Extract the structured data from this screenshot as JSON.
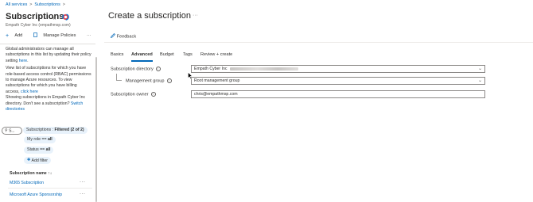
{
  "breadcrumb": [
    "All services",
    "Subscriptions"
  ],
  "left": {
    "title": "Subscriptions",
    "subtitle": "Empath Cyber Inc (empathmsp.com)",
    "toolbar": {
      "add": "Add",
      "manage_policies": "Manage Policies",
      "more": "···"
    },
    "info_p1_a": "Global administrators can manage all subscriptions in this list by updating their policy setting ",
    "info_p1_link": "here",
    "info_p1_b": ".",
    "info_p2_a": "View list of subscriptions for which you have role-based access control (RBAC) permissions to manage Azure resources. To view subscriptions for which you have billing access, ",
    "info_p2_link": "click here",
    "info_p3_a": "Showing subscriptions in Empath Cyber Inc directory. Don't see a subscription? ",
    "info_p3_link": "Switch directories",
    "search_placeholder": "S...",
    "filters": {
      "subscriptions_label": "Subscriptions : ",
      "subscriptions_value": "Filtered (2 of 2)",
      "role_label": "My role == ",
      "role_value": "all",
      "status_label": "Status == ",
      "status_value": "all",
      "add_filter": "Add filter"
    },
    "list_header": "Subscription name",
    "sort_glyph": "↑↓",
    "rows": [
      {
        "name": "M365 Subscription",
        "more": "···"
      },
      {
        "name": "Microsoft Azure Sponsorship",
        "more": "···"
      }
    ]
  },
  "main": {
    "title": "Create a subscription",
    "title_more": "···",
    "feedback": "Feedback",
    "tabs": [
      "Basics",
      "Advanced",
      "Budget",
      "Tags",
      "Review + create"
    ],
    "active_tab": "Advanced",
    "form": {
      "directory_label": "Subscription directory",
      "directory_value": "Empath Cyber Inc",
      "mgmt_group_label": "Management group",
      "mgmt_group_value": "Root management group",
      "owner_label": "Subscription owner",
      "owner_value": "chris@empathmsp.com"
    }
  },
  "colors": {
    "accent": "#0067b8",
    "pill_bg": "#e8f2fb",
    "border": "#8a8886"
  }
}
